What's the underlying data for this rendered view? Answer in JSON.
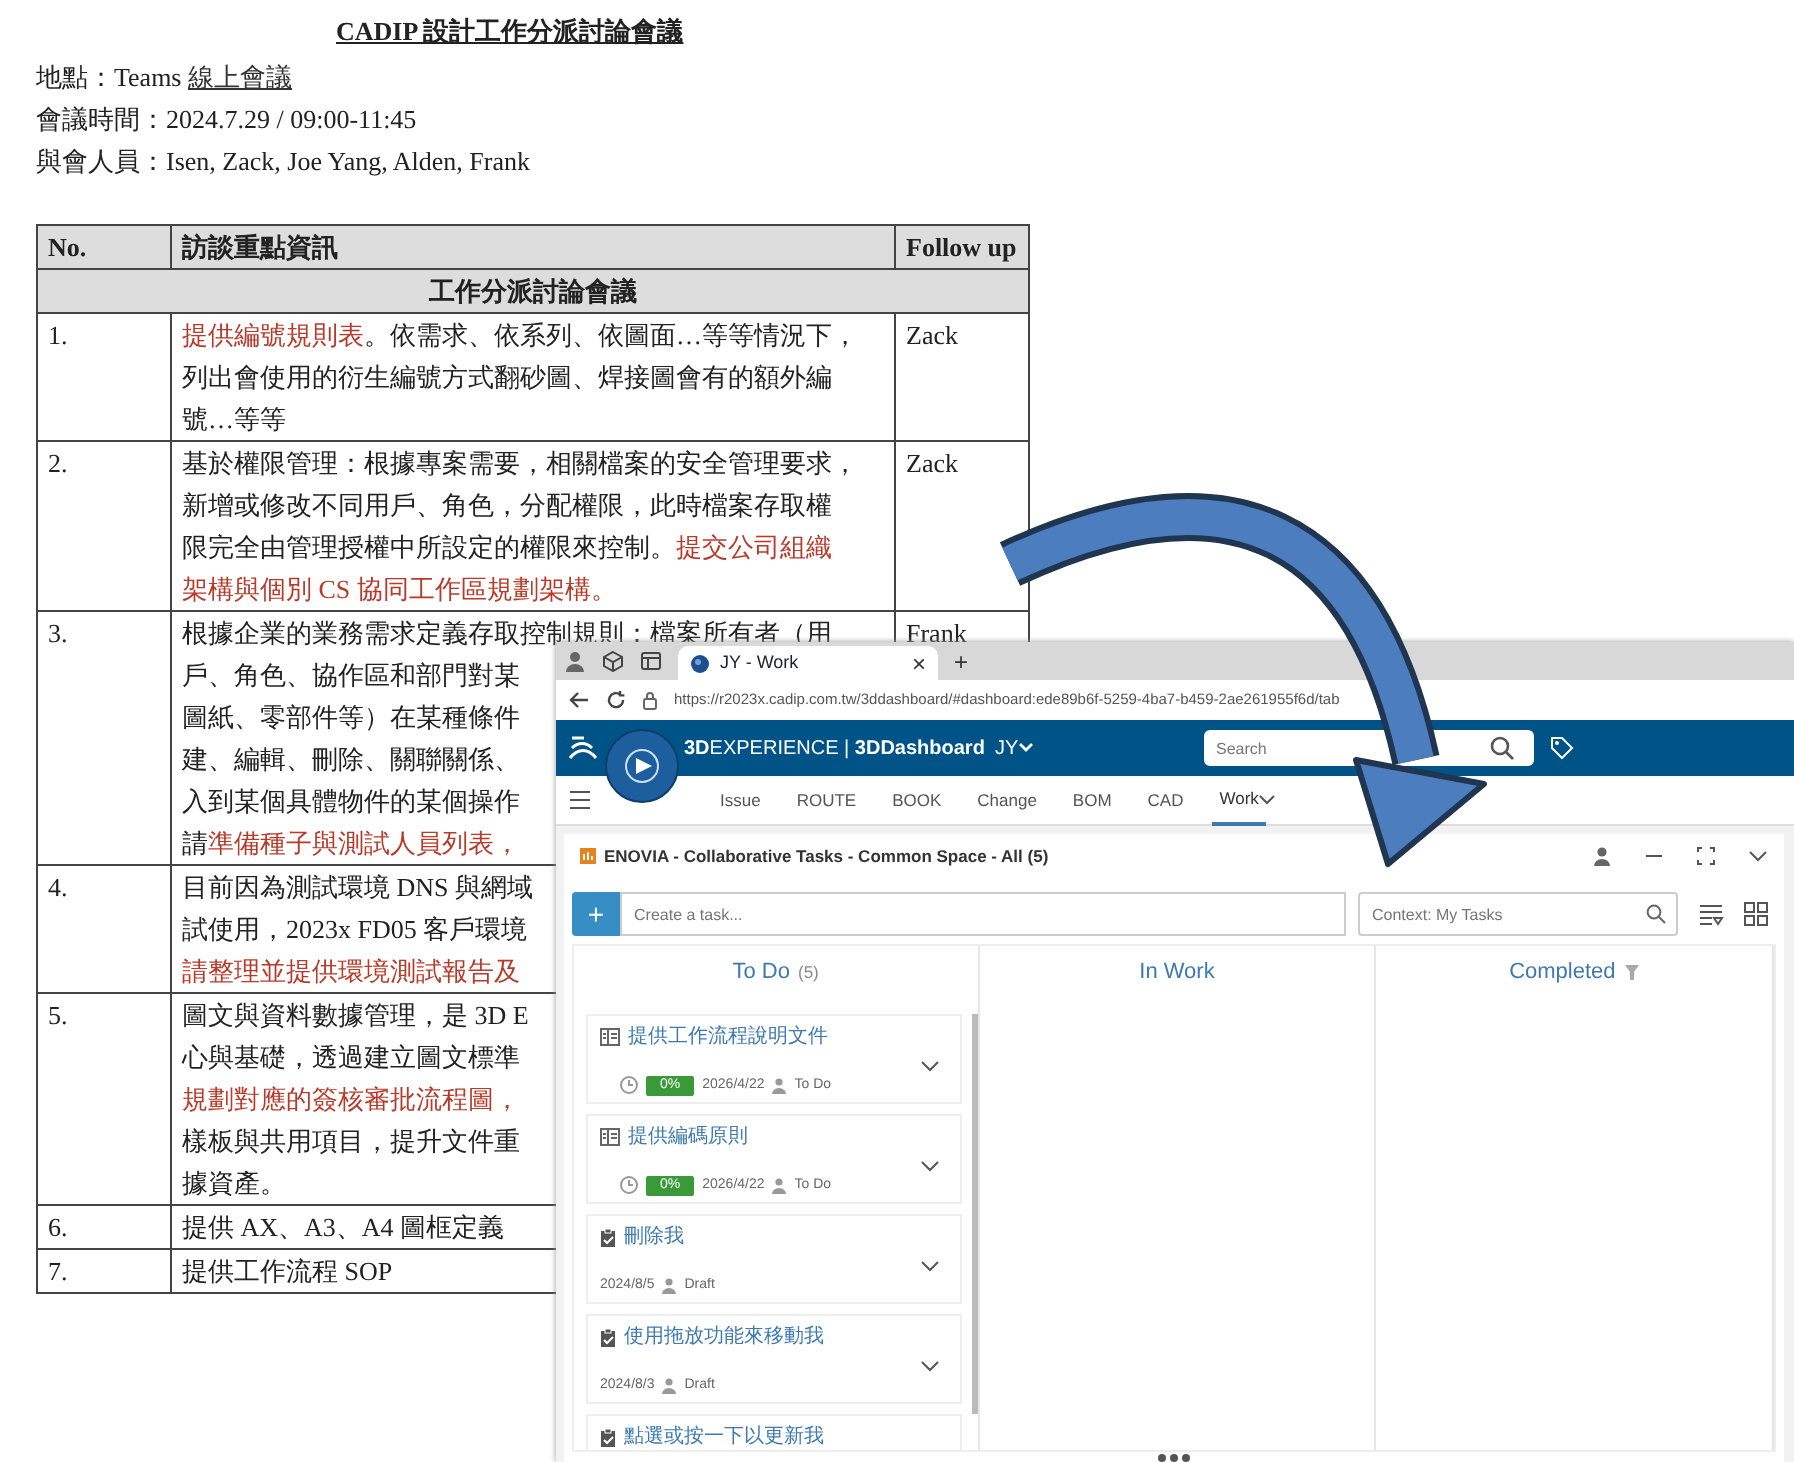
{
  "document": {
    "title": "CADIP 設計工作分派討論會議",
    "meta": [
      {
        "label": "地點：",
        "value": "Teams ",
        "link": "線上會議"
      },
      {
        "label": "會議時間：",
        "value": "2024.7.29 / 09:00-11:45"
      },
      {
        "label": "與會人員：",
        "value": "Isen, Zack, Joe Yang, Alden, Frank"
      }
    ],
    "table": {
      "columns": [
        "No.",
        "訪談重點資訊",
        "Follow up"
      ],
      "section": "工作分派討論會議",
      "rows": [
        {
          "no": "1.",
          "follow_up": "Zack",
          "lines": [
            [
              {
                "text": "提供編號規則表",
                "emphasis": true
              },
              {
                "text": "。依需求、依系列、依圖面…等等情況下，",
                "emphasis": false
              }
            ],
            [
              {
                "text": "列出會使用的衍生編號方式翻砂圖、焊接圖會有的額外編",
                "emphasis": false
              }
            ],
            [
              {
                "text": "號…等等",
                "emphasis": false
              }
            ]
          ]
        },
        {
          "no": "2.",
          "follow_up": "Zack",
          "lines": [
            [
              {
                "text": "基於權限管理：根據專案需要，相關檔案的安全管理要求，",
                "emphasis": false
              }
            ],
            [
              {
                "text": "新增或修改不同用戶、角色，分配權限，此時檔案存取權",
                "emphasis": false
              }
            ],
            [
              {
                "text": "限完全由管理授權中所設定的權限來控制。",
                "emphasis": false
              },
              {
                "text": "提交公司組織",
                "emphasis": true
              }
            ],
            [
              {
                "text": "架構與個別 CS 協同工作區規劃架構。",
                "emphasis": true
              }
            ]
          ]
        },
        {
          "no": "3.",
          "follow_up": "Frank",
          "lines": [
            [
              {
                "text": "根據企業的業務需求定義存取控制規則：檔案所有者（用",
                "emphasis": false
              }
            ],
            [
              {
                "text": "戶、角色、協作區和部門對某",
                "emphasis": false
              }
            ],
            [
              {
                "text": "圖紙、零部件等）在某種條件",
                "emphasis": false
              }
            ],
            [
              {
                "text": "建、編輯、刪除、關聯關係、",
                "emphasis": false
              }
            ],
            [
              {
                "text": "入到某個具體物件的某個操作",
                "emphasis": false
              }
            ],
            [
              {
                "text": "請",
                "emphasis": false
              },
              {
                "text": "準備種子與測試人員列表，",
                "emphasis": true
              }
            ]
          ]
        },
        {
          "no": "4.",
          "lines": [
            [
              {
                "text": "目前因為測試環境 DNS 與網域",
                "emphasis": false
              }
            ],
            [
              {
                "text": "試使用，2023x FD05 客戶環境",
                "emphasis": false
              }
            ],
            [
              {
                "text": "請整理並提供環境測試報告及",
                "emphasis": true
              }
            ]
          ]
        },
        {
          "no": "5.",
          "lines": [
            [
              {
                "text": "圖文與資料數據管理，是 3D E",
                "emphasis": false
              }
            ],
            [
              {
                "text": "心與基礎，透過建立圖文標準",
                "emphasis": false
              }
            ],
            [
              {
                "text": "規劃對應的簽核審批流程圖，",
                "emphasis": true
              }
            ],
            [
              {
                "text": "樣板與共用項目，提升文件重",
                "emphasis": false
              }
            ],
            [
              {
                "text": "據資產。",
                "emphasis": false
              }
            ]
          ]
        },
        {
          "no": "6.",
          "lines": [
            [
              {
                "text": "提供 AX、A3、A4 圖框定義",
                "emphasis": false
              }
            ]
          ]
        },
        {
          "no": "7.",
          "lines": [
            [
              {
                "text": "提供工作流程 SOP",
                "emphasis": false
              }
            ]
          ]
        }
      ]
    }
  },
  "browser": {
    "tab": {
      "title": "JY - Work",
      "close": "×"
    },
    "new_tab": "+",
    "url": "https://r2023x.cadip.com.tw/3ddashboard/#dashboard:ede89b6f-5259-4ba7-b459-2ae261955f6d/tab",
    "app_title": "**3D**EXPERIENCE | **3DDashboard**",
    "user": "JY",
    "search": {
      "placeholder": "Search"
    },
    "nav": [
      {
        "label": "Issue",
        "selected": false
      },
      {
        "label": "ROUTE",
        "selected": false
      },
      {
        "label": "BOOK",
        "selected": false
      },
      {
        "label": "Change",
        "selected": false
      },
      {
        "label": "BOM",
        "selected": false
      },
      {
        "label": "CAD",
        "selected": false
      },
      {
        "label": "Work",
        "selected": true
      }
    ],
    "widget": {
      "title": "ENOVIA - Collaborative Tasks - Common Space - All (5)",
      "create": {
        "button": "+",
        "placeholder": "Create a task..."
      },
      "context": {
        "placeholder": "Context: My Tasks"
      },
      "columns": [
        {
          "title": "To Do",
          "count": "(5)",
          "filter": false,
          "cards": [
            {
              "kind": "scheduled",
              "title": "提供工作流程說明文件",
              "progress": "0%",
              "date": "2026/4/22",
              "status": "To Do"
            },
            {
              "kind": "scheduled",
              "title": "提供編碼原則",
              "progress": "0%",
              "date": "2026/4/22",
              "status": "To Do"
            },
            {
              "kind": "draft",
              "title": "刪除我",
              "date": "2024/8/5",
              "status": "Draft"
            },
            {
              "kind": "draft",
              "title": "使用拖放功能來移動我",
              "date": "2024/8/3",
              "status": "Draft"
            },
            {
              "kind": "draft",
              "title": "點選或按一下以更新我"
            }
          ]
        },
        {
          "title": "In Work",
          "filter": false
        },
        {
          "title": "Completed",
          "filter": true
        }
      ]
    }
  }
}
